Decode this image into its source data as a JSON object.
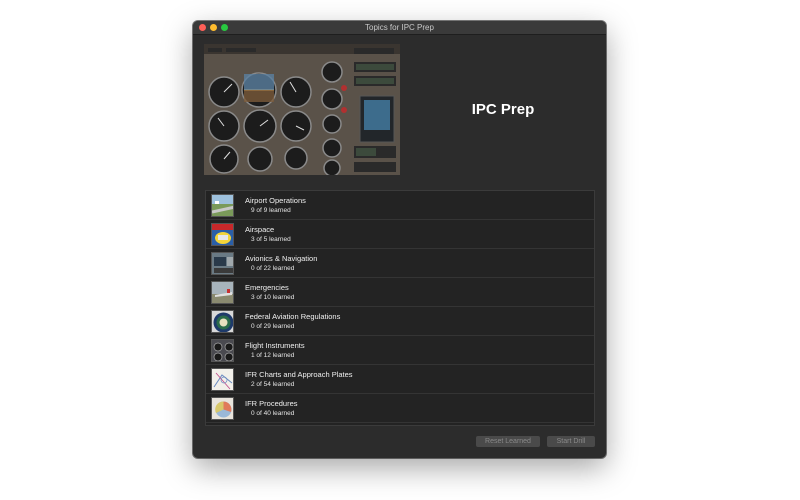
{
  "window": {
    "title": "Topics for IPC Prep"
  },
  "header": {
    "app_title": "IPC Prep"
  },
  "topics": [
    {
      "name": "Airport Operations",
      "progress": "9 of 9 learned",
      "icon": "airport-thumbnail"
    },
    {
      "name": "Airspace",
      "progress": "3 of 5 learned",
      "icon": "airspace-thumbnail"
    },
    {
      "name": "Avionics & Navigation",
      "progress": "0 of 22 learned",
      "icon": "avionics-thumbnail"
    },
    {
      "name": "Emergencies",
      "progress": "3 of 10 learned",
      "icon": "emergencies-thumbnail"
    },
    {
      "name": "Federal Aviation Regulations",
      "progress": "0 of 29 learned",
      "icon": "faa-seal-thumbnail"
    },
    {
      "name": "Flight Instruments",
      "progress": "1 of 12 learned",
      "icon": "instruments-thumbnail"
    },
    {
      "name": "IFR Charts and Approach Plates",
      "progress": "2 of 54 learned",
      "icon": "chart-thumbnail"
    },
    {
      "name": "IFR Procedures",
      "progress": "0 of 40 learned",
      "icon": "procedures-thumbnail"
    }
  ],
  "buttons": {
    "reset": "Reset Learned",
    "start": "Start Drill"
  }
}
